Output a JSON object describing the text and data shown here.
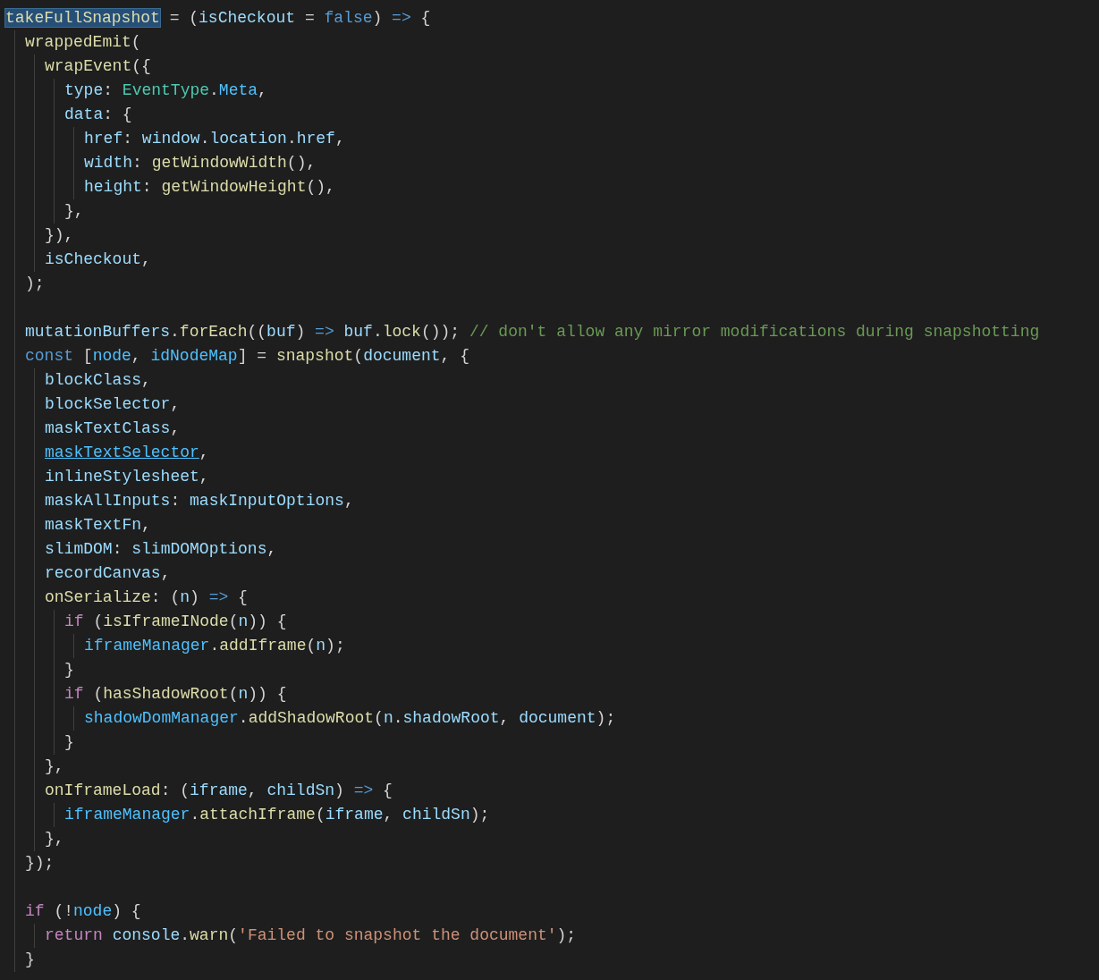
{
  "editor": {
    "lines": [
      {
        "kind": "code",
        "tokens": [
          {
            "text": "takeFullSnapshot",
            "kind": "highlighted"
          },
          {
            "text": " = (",
            "kind": "punc"
          },
          {
            "text": "isCheckout",
            "kind": "var"
          },
          {
            "text": " = ",
            "kind": "punc"
          },
          {
            "text": "false",
            "kind": "kw"
          },
          {
            "text": ") ",
            "kind": "punc"
          },
          {
            "text": "=>",
            "kind": "kw"
          },
          {
            "text": " {",
            "kind": "punc"
          }
        ],
        "children": [
          {
            "kind": "code",
            "tokens": [
              {
                "text": "wrappedEmit",
                "kind": "fn"
              },
              {
                "text": "(",
                "kind": "punc"
              }
            ],
            "children": [
              {
                "kind": "code",
                "tokens": [
                  {
                    "text": "wrapEvent",
                    "kind": "fn"
                  },
                  {
                    "text": "({",
                    "kind": "punc"
                  }
                ],
                "children": [
                  {
                    "kind": "code",
                    "tokens": [
                      {
                        "text": "type",
                        "kind": "var"
                      },
                      {
                        "text": ": ",
                        "kind": "punc"
                      },
                      {
                        "text": "EventType",
                        "kind": "type"
                      },
                      {
                        "text": ".",
                        "kind": "punc"
                      },
                      {
                        "text": "Meta",
                        "kind": "const"
                      },
                      {
                        "text": ",",
                        "kind": "punc"
                      }
                    ]
                  },
                  {
                    "kind": "code",
                    "tokens": [
                      {
                        "text": "data",
                        "kind": "var"
                      },
                      {
                        "text": ": {",
                        "kind": "punc"
                      }
                    ],
                    "children": [
                      {
                        "kind": "code",
                        "tokens": [
                          {
                            "text": "href",
                            "kind": "var"
                          },
                          {
                            "text": ": ",
                            "kind": "punc"
                          },
                          {
                            "text": "window",
                            "kind": "var"
                          },
                          {
                            "text": ".",
                            "kind": "punc"
                          },
                          {
                            "text": "location",
                            "kind": "var"
                          },
                          {
                            "text": ".",
                            "kind": "punc"
                          },
                          {
                            "text": "href",
                            "kind": "var"
                          },
                          {
                            "text": ",",
                            "kind": "punc"
                          }
                        ]
                      },
                      {
                        "kind": "code",
                        "tokens": [
                          {
                            "text": "width",
                            "kind": "var"
                          },
                          {
                            "text": ": ",
                            "kind": "punc"
                          },
                          {
                            "text": "getWindowWidth",
                            "kind": "fn"
                          },
                          {
                            "text": "(),",
                            "kind": "punc"
                          }
                        ]
                      },
                      {
                        "kind": "code",
                        "tokens": [
                          {
                            "text": "height",
                            "kind": "var"
                          },
                          {
                            "text": ": ",
                            "kind": "punc"
                          },
                          {
                            "text": "getWindowHeight",
                            "kind": "fn"
                          },
                          {
                            "text": "(),",
                            "kind": "punc"
                          }
                        ]
                      }
                    ]
                  },
                  {
                    "kind": "code",
                    "tokens": [
                      {
                        "text": "},",
                        "kind": "punc"
                      }
                    ]
                  }
                ]
              },
              {
                "kind": "code",
                "tokens": [
                  {
                    "text": "}),",
                    "kind": "punc"
                  }
                ]
              },
              {
                "kind": "code",
                "tokens": [
                  {
                    "text": "isCheckout",
                    "kind": "var"
                  },
                  {
                    "text": ",",
                    "kind": "punc"
                  }
                ]
              }
            ]
          },
          {
            "kind": "code",
            "tokens": [
              {
                "text": ");",
                "kind": "punc"
              }
            ]
          },
          {
            "kind": "blank"
          },
          {
            "kind": "code",
            "tokens": [
              {
                "text": "mutationBuffers",
                "kind": "var"
              },
              {
                "text": ".",
                "kind": "punc"
              },
              {
                "text": "forEach",
                "kind": "fn"
              },
              {
                "text": "((",
                "kind": "punc"
              },
              {
                "text": "buf",
                "kind": "var"
              },
              {
                "text": ") ",
                "kind": "punc"
              },
              {
                "text": "=> ",
                "kind": "kw"
              },
              {
                "text": "buf",
                "kind": "var"
              },
              {
                "text": ".",
                "kind": "punc"
              },
              {
                "text": "lock",
                "kind": "fn"
              },
              {
                "text": "()); ",
                "kind": "punc"
              },
              {
                "text": "// don't allow any mirror modifications during snapshotting",
                "kind": "comment"
              }
            ]
          },
          {
            "kind": "code",
            "tokens": [
              {
                "text": "const",
                "kind": "kw"
              },
              {
                "text": " [",
                "kind": "punc"
              },
              {
                "text": "node",
                "kind": "const"
              },
              {
                "text": ", ",
                "kind": "punc"
              },
              {
                "text": "idNodeMap",
                "kind": "const"
              },
              {
                "text": "] = ",
                "kind": "punc"
              },
              {
                "text": "snapshot",
                "kind": "fn"
              },
              {
                "text": "(",
                "kind": "punc"
              },
              {
                "text": "document",
                "kind": "var"
              },
              {
                "text": ", {",
                "kind": "punc"
              }
            ],
            "children": [
              {
                "kind": "code",
                "tokens": [
                  {
                    "text": "blockClass",
                    "kind": "var"
                  },
                  {
                    "text": ",",
                    "kind": "punc"
                  }
                ]
              },
              {
                "kind": "code",
                "tokens": [
                  {
                    "text": "blockSelector",
                    "kind": "var"
                  },
                  {
                    "text": ",",
                    "kind": "punc"
                  }
                ]
              },
              {
                "kind": "code",
                "tokens": [
                  {
                    "text": "maskTextClass",
                    "kind": "var"
                  },
                  {
                    "text": ",",
                    "kind": "punc"
                  }
                ]
              },
              {
                "kind": "code",
                "tokens": [
                  {
                    "text": "maskTextSelector",
                    "kind": "link"
                  },
                  {
                    "text": ",",
                    "kind": "punc"
                  }
                ]
              },
              {
                "kind": "code",
                "tokens": [
                  {
                    "text": "inlineStylesheet",
                    "kind": "var"
                  },
                  {
                    "text": ",",
                    "kind": "punc"
                  }
                ]
              },
              {
                "kind": "code",
                "tokens": [
                  {
                    "text": "maskAllInputs",
                    "kind": "var"
                  },
                  {
                    "text": ": ",
                    "kind": "punc"
                  },
                  {
                    "text": "maskInputOptions",
                    "kind": "var"
                  },
                  {
                    "text": ",",
                    "kind": "punc"
                  }
                ]
              },
              {
                "kind": "code",
                "tokens": [
                  {
                    "text": "maskTextFn",
                    "kind": "var"
                  },
                  {
                    "text": ",",
                    "kind": "punc"
                  }
                ]
              },
              {
                "kind": "code",
                "tokens": [
                  {
                    "text": "slimDOM",
                    "kind": "var"
                  },
                  {
                    "text": ": ",
                    "kind": "punc"
                  },
                  {
                    "text": "slimDOMOptions",
                    "kind": "var"
                  },
                  {
                    "text": ",",
                    "kind": "punc"
                  }
                ]
              },
              {
                "kind": "code",
                "tokens": [
                  {
                    "text": "recordCanvas",
                    "kind": "var"
                  },
                  {
                    "text": ",",
                    "kind": "punc"
                  }
                ]
              },
              {
                "kind": "code",
                "tokens": [
                  {
                    "text": "onSerialize",
                    "kind": "fn"
                  },
                  {
                    "text": ": (",
                    "kind": "punc"
                  },
                  {
                    "text": "n",
                    "kind": "var"
                  },
                  {
                    "text": ") ",
                    "kind": "punc"
                  },
                  {
                    "text": "=>",
                    "kind": "kw"
                  },
                  {
                    "text": " {",
                    "kind": "punc"
                  }
                ],
                "children": [
                  {
                    "kind": "code",
                    "tokens": [
                      {
                        "text": "if",
                        "kind": "control"
                      },
                      {
                        "text": " (",
                        "kind": "punc"
                      },
                      {
                        "text": "isIframeINode",
                        "kind": "fn"
                      },
                      {
                        "text": "(",
                        "kind": "punc"
                      },
                      {
                        "text": "n",
                        "kind": "var"
                      },
                      {
                        "text": ")) {",
                        "kind": "punc"
                      }
                    ],
                    "children": [
                      {
                        "kind": "code",
                        "tokens": [
                          {
                            "text": "iframeManager",
                            "kind": "const"
                          },
                          {
                            "text": ".",
                            "kind": "punc"
                          },
                          {
                            "text": "addIframe",
                            "kind": "fn"
                          },
                          {
                            "text": "(",
                            "kind": "punc"
                          },
                          {
                            "text": "n",
                            "kind": "var"
                          },
                          {
                            "text": ");",
                            "kind": "punc"
                          }
                        ]
                      }
                    ]
                  },
                  {
                    "kind": "code",
                    "tokens": [
                      {
                        "text": "}",
                        "kind": "punc"
                      }
                    ]
                  },
                  {
                    "kind": "code",
                    "tokens": [
                      {
                        "text": "if",
                        "kind": "control"
                      },
                      {
                        "text": " (",
                        "kind": "punc"
                      },
                      {
                        "text": "hasShadowRoot",
                        "kind": "fn"
                      },
                      {
                        "text": "(",
                        "kind": "punc"
                      },
                      {
                        "text": "n",
                        "kind": "var"
                      },
                      {
                        "text": ")) {",
                        "kind": "punc"
                      }
                    ],
                    "children": [
                      {
                        "kind": "code",
                        "tokens": [
                          {
                            "text": "shadowDomManager",
                            "kind": "const"
                          },
                          {
                            "text": ".",
                            "kind": "punc"
                          },
                          {
                            "text": "addShadowRoot",
                            "kind": "fn"
                          },
                          {
                            "text": "(",
                            "kind": "punc"
                          },
                          {
                            "text": "n",
                            "kind": "var"
                          },
                          {
                            "text": ".",
                            "kind": "punc"
                          },
                          {
                            "text": "shadowRoot",
                            "kind": "var"
                          },
                          {
                            "text": ", ",
                            "kind": "punc"
                          },
                          {
                            "text": "document",
                            "kind": "var"
                          },
                          {
                            "text": ");",
                            "kind": "punc"
                          }
                        ]
                      }
                    ]
                  },
                  {
                    "kind": "code",
                    "tokens": [
                      {
                        "text": "}",
                        "kind": "punc"
                      }
                    ]
                  }
                ]
              },
              {
                "kind": "code",
                "tokens": [
                  {
                    "text": "},",
                    "kind": "punc"
                  }
                ]
              },
              {
                "kind": "code",
                "tokens": [
                  {
                    "text": "onIframeLoad",
                    "kind": "fn"
                  },
                  {
                    "text": ": (",
                    "kind": "punc"
                  },
                  {
                    "text": "iframe",
                    "kind": "var"
                  },
                  {
                    "text": ", ",
                    "kind": "punc"
                  },
                  {
                    "text": "childSn",
                    "kind": "var"
                  },
                  {
                    "text": ") ",
                    "kind": "punc"
                  },
                  {
                    "text": "=>",
                    "kind": "kw"
                  },
                  {
                    "text": " {",
                    "kind": "punc"
                  }
                ],
                "children": [
                  {
                    "kind": "code",
                    "tokens": [
                      {
                        "text": "iframeManager",
                        "kind": "const"
                      },
                      {
                        "text": ".",
                        "kind": "punc"
                      },
                      {
                        "text": "attachIframe",
                        "kind": "fn"
                      },
                      {
                        "text": "(",
                        "kind": "punc"
                      },
                      {
                        "text": "iframe",
                        "kind": "var"
                      },
                      {
                        "text": ", ",
                        "kind": "punc"
                      },
                      {
                        "text": "childSn",
                        "kind": "var"
                      },
                      {
                        "text": ");",
                        "kind": "punc"
                      }
                    ]
                  }
                ]
              },
              {
                "kind": "code",
                "tokens": [
                  {
                    "text": "},",
                    "kind": "punc"
                  }
                ]
              }
            ]
          },
          {
            "kind": "code",
            "tokens": [
              {
                "text": "});",
                "kind": "punc"
              }
            ]
          },
          {
            "kind": "blank"
          },
          {
            "kind": "code",
            "tokens": [
              {
                "text": "if",
                "kind": "control"
              },
              {
                "text": " (!",
                "kind": "punc"
              },
              {
                "text": "node",
                "kind": "const"
              },
              {
                "text": ") {",
                "kind": "punc"
              }
            ],
            "children": [
              {
                "kind": "code",
                "tokens": [
                  {
                    "text": "return ",
                    "kind": "control"
                  },
                  {
                    "text": "console",
                    "kind": "var"
                  },
                  {
                    "text": ".",
                    "kind": "punc"
                  },
                  {
                    "text": "warn",
                    "kind": "fn"
                  },
                  {
                    "text": "(",
                    "kind": "punc"
                  },
                  {
                    "text": "'Failed to snapshot the document'",
                    "kind": "string"
                  },
                  {
                    "text": ");",
                    "kind": "punc"
                  }
                ]
              }
            ]
          },
          {
            "kind": "code",
            "tokens": [
              {
                "text": "}",
                "kind": "punc"
              }
            ]
          }
        ]
      }
    ]
  }
}
